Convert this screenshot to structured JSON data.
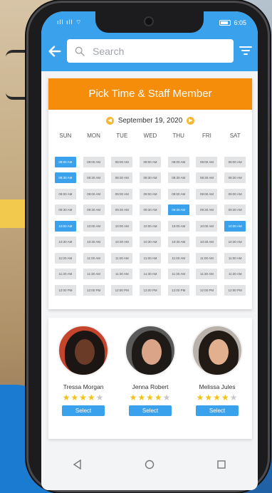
{
  "status": {
    "left": "ıll ıll ⌔",
    "time": "6:05"
  },
  "search": {
    "placeholder": "Search"
  },
  "header": {
    "title": "Pick Time & Staff Member"
  },
  "calendar": {
    "date": "September 19, 2020",
    "days": [
      "SUN",
      "MON",
      "TUE",
      "WED",
      "THU",
      "FRI",
      "SAT"
    ],
    "times": [
      "08:00 AM",
      "08:30 AM",
      "09:00 AM",
      "09:30 AM",
      "10:00 AM",
      "10:30 AM",
      "11:00 AM",
      "11:30 AM",
      "12:00 PM"
    ],
    "selected": [
      [
        0,
        0
      ],
      [
        1,
        0
      ],
      [
        3,
        4
      ],
      [
        4,
        0
      ],
      [
        4,
        6
      ]
    ]
  },
  "staff": [
    {
      "name": "Tressa Morgan",
      "rating": 4,
      "select_label": "Select"
    },
    {
      "name": "Jenna Robert",
      "rating": 4,
      "select_label": "Select"
    },
    {
      "name": "Melissa Jules",
      "rating": 4,
      "select_label": "Select"
    }
  ],
  "colors": {
    "accent": "#3aa1ec",
    "header": "#f58c0a",
    "star": "#f2c21a"
  }
}
